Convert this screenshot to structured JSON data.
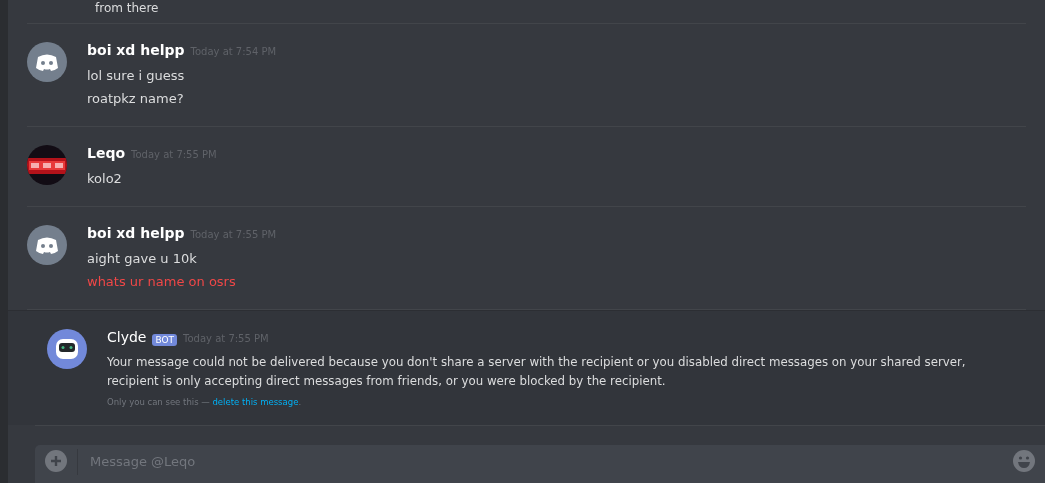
{
  "previous_message": {
    "lines": [
      "from there"
    ]
  },
  "messages": [
    {
      "author": "boi xd helpp",
      "timestamp": "Today at 7:54 PM",
      "avatar": {
        "kind": "default"
      },
      "lines": [
        {
          "text": "lol sure i guess",
          "kind": "normal"
        },
        {
          "text": "roatpkz name?",
          "kind": "normal"
        }
      ]
    },
    {
      "author": "Leqo",
      "timestamp": "Today at 7:55 PM",
      "avatar": {
        "kind": "picture"
      },
      "lines": [
        {
          "text": "kolo2",
          "kind": "normal"
        }
      ]
    },
    {
      "author": "boi xd helpp",
      "timestamp": "Today at 7:55 PM",
      "avatar": {
        "kind": "default"
      },
      "lines": [
        {
          "text": "aight gave u 10k",
          "kind": "normal"
        },
        {
          "text": "whats ur name on osrs",
          "kind": "error"
        }
      ]
    }
  ],
  "system_message": {
    "author": "Clyde",
    "badge": "BOT",
    "timestamp": "Today at 7:55 PM",
    "text": "Your message could not be delivered because you don't share a server with the recipient or you disabled direct messages on your shared server, recipient is only accepting direct messages from friends, or you were blocked by the recipient.",
    "note": "Only you can see this —",
    "link": "delete this message",
    "note_end": "."
  },
  "composer": {
    "placeholder": "Message @Leqo"
  }
}
